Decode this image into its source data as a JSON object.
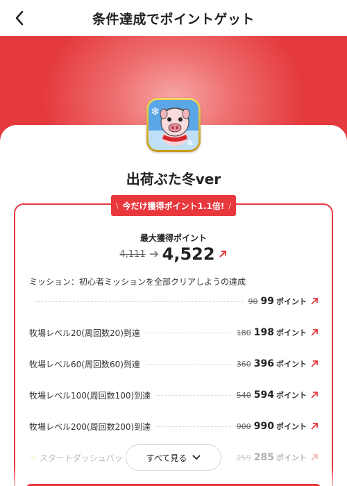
{
  "header": {
    "title": "条件達成でポイントゲット",
    "back_icon": "chevron-left-icon"
  },
  "app": {
    "name": "出荷ぶた冬ver",
    "icon": "pig-app-icon"
  },
  "promo": {
    "badge_text": "今だけ獲得ポイント1.1倍!",
    "badge_slash_left": "\\",
    "badge_slash_right": "/"
  },
  "max_points": {
    "label": "最大獲得ポイント",
    "old_value": "4,111",
    "new_value": "4,522"
  },
  "mission_intro": "ミッション：初心者ミッションを全部クリアしようの達成",
  "missions": [
    {
      "label": "",
      "old": "90",
      "new": "99",
      "unit": "ポイント"
    },
    {
      "label": "牧場レベル20(周回数20)到達",
      "old": "180",
      "new": "198",
      "unit": "ポイント"
    },
    {
      "label": "牧場レベル60(周回数60)到達",
      "old": "360",
      "new": "396",
      "unit": "ポイント"
    },
    {
      "label": "牧場レベル100(周回数100)到達",
      "old": "540",
      "new": "594",
      "unit": "ポイント"
    },
    {
      "label": "牧場レベル200(周回数200)到達",
      "old": "900",
      "new": "990",
      "unit": "ポイント"
    },
    {
      "label": "スタートダッシュバッ",
      "old": "259",
      "new": "285",
      "unit": "ポイント"
    }
  ],
  "see_all": {
    "label": "すべて見る"
  },
  "colors": {
    "accent": "#e8373d",
    "hero_center": "#f7a7a7",
    "hero_edge": "#e4393d"
  }
}
